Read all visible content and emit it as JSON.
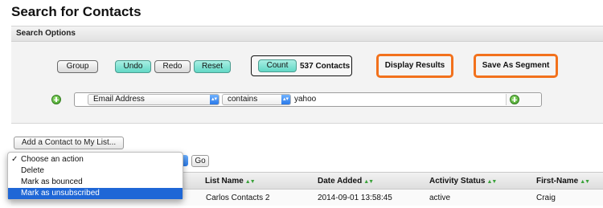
{
  "page_title": "Search for Contacts",
  "search_options": {
    "section_label": "Search Options",
    "group_label": "Group",
    "undo_label": "Undo",
    "redo_label": "Redo",
    "reset_label": "Reset",
    "count_label": "Count",
    "contacts_count": "537 Contacts",
    "display_results_label": "Display Results",
    "save_segment_label": "Save As Segment",
    "filter": {
      "field": "Email Address",
      "operator": "contains",
      "value": "yahoo"
    }
  },
  "actions": {
    "add_to_list_label": "Add a Contact to My List...",
    "go_label": "Go",
    "menu": {
      "items": [
        {
          "label": "Choose an action",
          "checked": true
        },
        {
          "label": "Delete"
        },
        {
          "label": "Mark as bounced"
        },
        {
          "label": "Mark as unsubscribed",
          "highlighted": true
        }
      ]
    }
  },
  "table": {
    "columns": [
      "List Name",
      "Date Added",
      "Activity Status",
      "First-Name"
    ],
    "rows": [
      {
        "list_name": "Carlos Contacts 2",
        "date_added": "2014-09-01 13:58:45",
        "activity_status": "active",
        "first_name": "Craig"
      }
    ]
  },
  "colors": {
    "accent_teal": "#62d8c6",
    "highlight_orange": "#f2711c",
    "selected_blue": "#1f67d6",
    "add_icon_green": "#3e9d23"
  },
  "icons": {
    "add_filter": "plus-circle-icon",
    "sort": "sort-arrows-icon",
    "select_arrow": "chevron-updown-icon",
    "checkmark": "checkmark-icon"
  }
}
